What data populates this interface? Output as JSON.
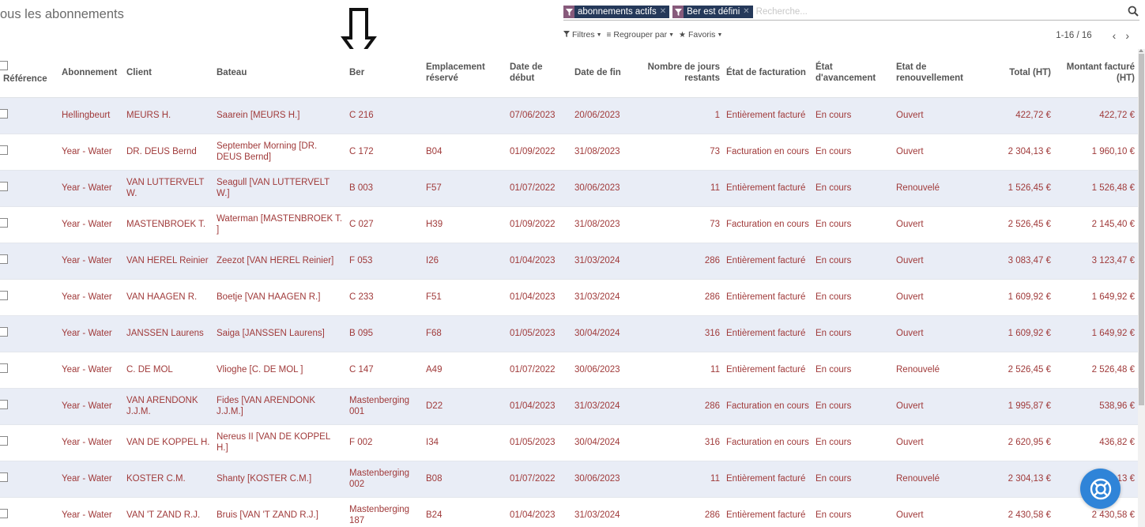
{
  "header": {
    "title": "ous les abonnements",
    "search": {
      "facets": [
        {
          "label": "abonnements actifs",
          "icon": "filter-icon"
        },
        {
          "label": "Ber est défini",
          "icon": "filter-icon"
        }
      ],
      "placeholder": "Recherche..."
    },
    "filters_label": "Filtres",
    "groupby_label": "Regrouper par",
    "favorites_label": "Favoris",
    "pager_value": "1-16 / 16"
  },
  "columns": [
    "Référence",
    "Abonnement",
    "Client",
    "Bateau",
    "Ber",
    "Emplacement réservé",
    "Date de début",
    "Date de fin",
    "Nombre de jours restants",
    "État de facturation",
    "État d'avancement",
    "Etat de renouvellement",
    "Total (HT)",
    "Montant facturé (HT)"
  ],
  "rows": [
    {
      "reference": "",
      "abonnement": "Hellingbeurt",
      "client": "MEURS H.",
      "bateau": "Saarein [MEURS H.]",
      "ber": "C 216",
      "emplacement": "",
      "debut": "07/06/2023",
      "fin": "20/06/2023",
      "jours": "1",
      "facturation": "Entièrement facturé",
      "avancement": "En cours",
      "renouvellement": "Ouvert",
      "total": "422,72 €",
      "facture": "422,72 €"
    },
    {
      "reference": "",
      "abonnement": "Year - Water",
      "client": "DR. DEUS Bernd",
      "bateau": "September Morning [DR. DEUS Bernd]",
      "ber": "C 172",
      "emplacement": "B04",
      "debut": "01/09/2022",
      "fin": "31/08/2023",
      "jours": "73",
      "facturation": "Facturation en cours",
      "avancement": "En cours",
      "renouvellement": "Ouvert",
      "total": "2 304,13 €",
      "facture": "1 960,10 €"
    },
    {
      "reference": "",
      "abonnement": "Year - Water",
      "client": "VAN LUTTERVELT W.",
      "bateau": "Seagull [VAN LUTTERVELT W.]",
      "ber": "B 003",
      "emplacement": "F57",
      "debut": "01/07/2022",
      "fin": "30/06/2023",
      "jours": "11",
      "facturation": "Entièrement facturé",
      "avancement": "En cours",
      "renouvellement": "Renouvelé",
      "total": "1 526,45 €",
      "facture": "1 526,48 €"
    },
    {
      "reference": "",
      "abonnement": "Year - Water",
      "client": "MASTENBROEK T.",
      "bateau": "Waterman [MASTENBROEK T. ]",
      "ber": "C 027",
      "emplacement": "H39",
      "debut": "01/09/2022",
      "fin": "31/08/2023",
      "jours": "73",
      "facturation": "Facturation en cours",
      "avancement": "En cours",
      "renouvellement": "Ouvert",
      "total": "2 526,45 €",
      "facture": "2 145,40 €"
    },
    {
      "reference": "",
      "abonnement": "Year - Water",
      "client": "VAN HEREL Reinier",
      "bateau": "Zeezot [VAN HEREL Reinier]",
      "ber": "F 053",
      "emplacement": "I26",
      "debut": "01/04/2023",
      "fin": "31/03/2024",
      "jours": "286",
      "facturation": "Entièrement facturé",
      "avancement": "En cours",
      "renouvellement": "Ouvert",
      "total": "3 083,47 €",
      "facture": "3 123,47 €"
    },
    {
      "reference": "",
      "abonnement": "Year - Water",
      "client": "VAN HAAGEN R.",
      "bateau": "Boetje [VAN HAAGEN R.]",
      "ber": "C 233",
      "emplacement": "F51",
      "debut": "01/04/2023",
      "fin": "31/03/2024",
      "jours": "286",
      "facturation": "Entièrement facturé",
      "avancement": "En cours",
      "renouvellement": "Ouvert",
      "total": "1 609,92 €",
      "facture": "1 649,92 €"
    },
    {
      "reference": "",
      "abonnement": "Year - Water",
      "client": "JANSSEN Laurens",
      "bateau": "Saiga [JANSSEN Laurens]",
      "ber": "B 095",
      "emplacement": "F68",
      "debut": "01/05/2023",
      "fin": "30/04/2024",
      "jours": "316",
      "facturation": "Entièrement facturé",
      "avancement": "En cours",
      "renouvellement": "Ouvert",
      "total": "1 609,92 €",
      "facture": "1 649,92 €"
    },
    {
      "reference": "",
      "abonnement": "Year - Water",
      "client": "C. DE MOL",
      "bateau": "Vlioghe [C. DE MOL ]",
      "ber": "C 147",
      "emplacement": "A49",
      "debut": "01/07/2022",
      "fin": "30/06/2023",
      "jours": "11",
      "facturation": "Entièrement facturé",
      "avancement": "En cours",
      "renouvellement": "Renouvelé",
      "total": "2 526,45 €",
      "facture": "2 526,48 €"
    },
    {
      "reference": "",
      "abonnement": "Year - Water",
      "client": "VAN ARENDONK J.J.M.",
      "bateau": "Fides [VAN ARENDONK J.J.M.]",
      "ber": "Mastenberging 001",
      "emplacement": "D22",
      "debut": "01/04/2023",
      "fin": "31/03/2024",
      "jours": "286",
      "facturation": "Facturation en cours",
      "avancement": "En cours",
      "renouvellement": "Ouvert",
      "total": "1 995,87 €",
      "facture": "538,96 €"
    },
    {
      "reference": "",
      "abonnement": "Year - Water",
      "client": "VAN DE KOPPEL H.",
      "bateau": "Nereus II [VAN DE KOPPEL H.]",
      "ber": "F 002",
      "emplacement": "I34",
      "debut": "01/05/2023",
      "fin": "30/04/2024",
      "jours": "316",
      "facturation": "Facturation en cours",
      "avancement": "En cours",
      "renouvellement": "Ouvert",
      "total": "2 620,95 €",
      "facture": "436,82 €"
    },
    {
      "reference": "",
      "abonnement": "Year - Water",
      "client": "KOSTER C.M.",
      "bateau": "Shanty [KOSTER C.M.]",
      "ber": "Mastenberging 002",
      "emplacement": "B08",
      "debut": "01/07/2022",
      "fin": "30/06/2023",
      "jours": "11",
      "facturation": "Entièrement facturé",
      "avancement": "En cours",
      "renouvellement": "Renouvelé",
      "total": "2 304,13 €",
      "facture": "2 304,13 €"
    },
    {
      "reference": "",
      "abonnement": "Year - Water",
      "client": "VAN 'T ZAND R.J.",
      "bateau": "Bruis [VAN 'T ZAND R.J.]",
      "ber": "Mastenberging 187",
      "emplacement": "B24",
      "debut": "01/04/2023",
      "fin": "31/03/2024",
      "jours": "286",
      "facturation": "Entièrement facturé",
      "avancement": "En cours",
      "renouvellement": "Ouvert",
      "total": "2 430,58 €",
      "facture": "2 430,58 €"
    }
  ],
  "colors": {
    "row_text": "#a03a3a",
    "stripe": "#e9edf6",
    "facet_icon_bg": "#875a7b",
    "facet_bg": "#25395a",
    "help_button": "#2f84d8"
  }
}
